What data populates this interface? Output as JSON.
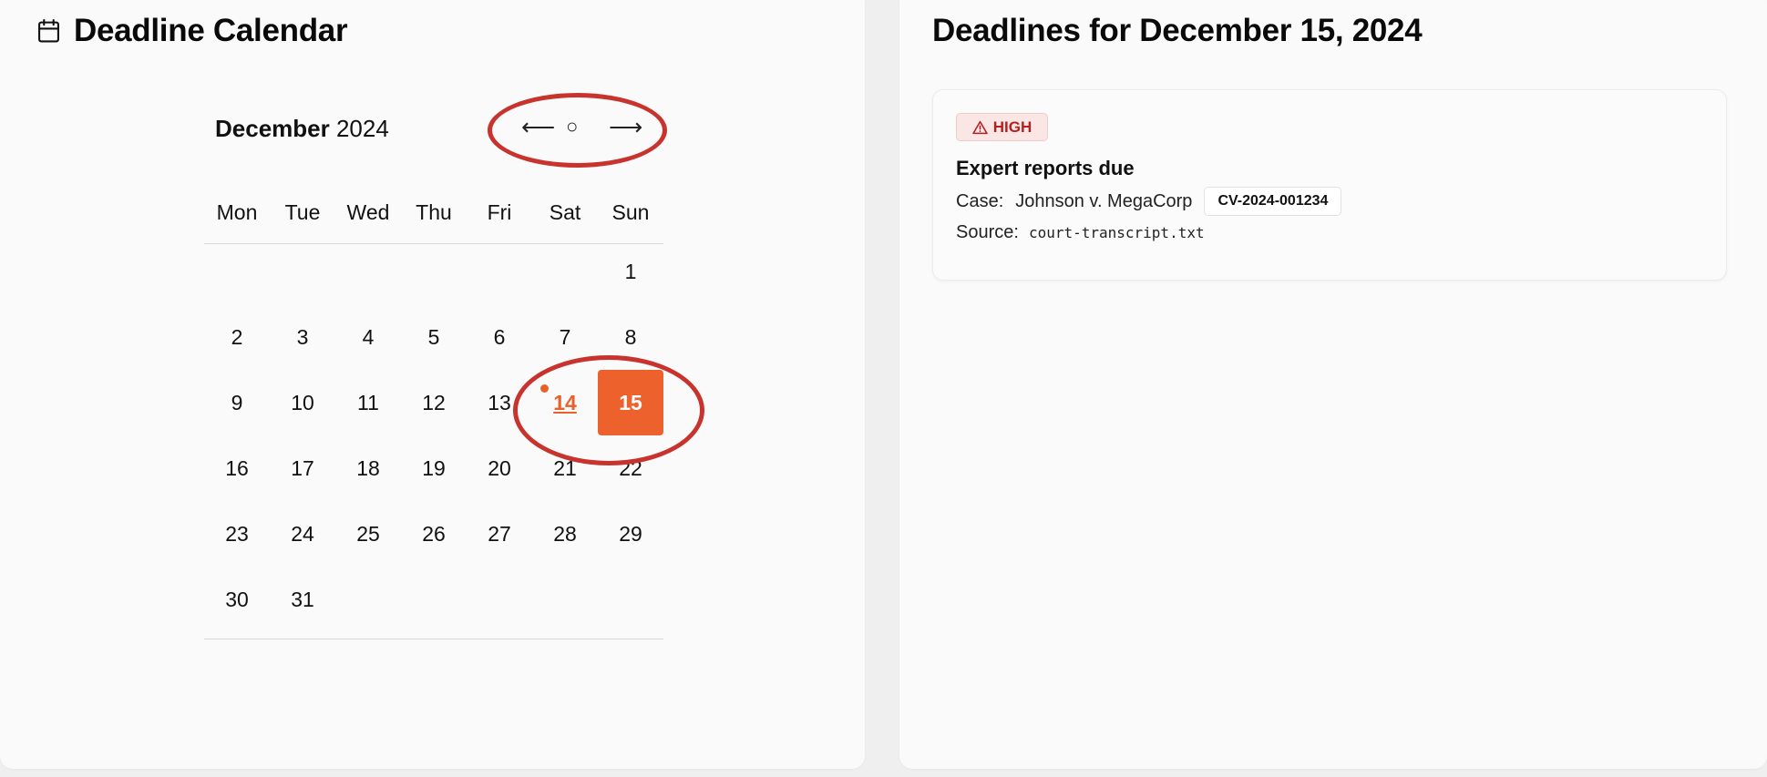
{
  "calendar": {
    "title": "Deadline Calendar",
    "month": "December",
    "year": "2024",
    "nav": {
      "prev": "⟵",
      "today": "○",
      "next": "⟶"
    },
    "weekdays": [
      "Mon",
      "Tue",
      "Wed",
      "Thu",
      "Fri",
      "Sat",
      "Sun"
    ],
    "days": [
      "1",
      "2",
      "3",
      "4",
      "5",
      "6",
      "7",
      "8",
      "9",
      "10",
      "11",
      "12",
      "13",
      "14",
      "15",
      "16",
      "17",
      "18",
      "19",
      "20",
      "21",
      "22",
      "23",
      "24",
      "25",
      "26",
      "27",
      "28",
      "29",
      "30",
      "31"
    ],
    "deadline_day": "14",
    "selected_day": "15"
  },
  "details": {
    "title": "Deadlines for December 15, 2024",
    "deadline": {
      "priority": "HIGH",
      "title": "Expert reports due",
      "case_label": "Case:",
      "case_name": "Johnson v. MegaCorp",
      "case_id": "CV-2024-001234",
      "source_label": "Source:",
      "source_file": "court-transcript.txt"
    }
  },
  "colors": {
    "accent": "#ec612c",
    "high_priority": "#b42020",
    "annotation_circle": "#c8332e"
  },
  "icons": {
    "calendar": "calendar-icon",
    "warning": "warning-triangle-icon"
  }
}
